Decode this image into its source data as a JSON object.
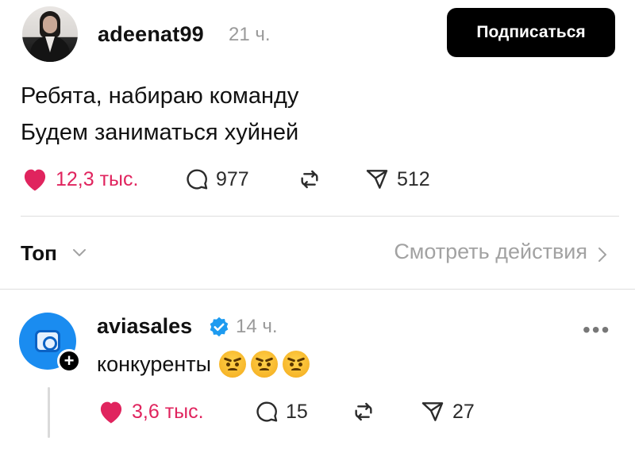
{
  "post": {
    "username": "adeenat99",
    "time": "21 ч.",
    "follow_label": "Подписаться",
    "text_lines": [
      "Ребята, набираю команду",
      "Будем заниматься хуйней"
    ],
    "likes": "12,3 тыс.",
    "comments": "977",
    "shares": "512"
  },
  "filter": {
    "sort_label": "Топ",
    "see_actions": "Смотреть действия"
  },
  "reply": {
    "username": "aviasales",
    "time": "14 ч.",
    "more": "•••",
    "text": "конкуренты",
    "emojis": [
      "angry-face",
      "angry-face",
      "angry-face"
    ],
    "likes": "3,6 тыс.",
    "comments": "15",
    "shares": "27",
    "plus": "+"
  },
  "colors": {
    "like": "#e0245e",
    "verified": "#1d9bf0",
    "muted": "#9a9a9a"
  }
}
